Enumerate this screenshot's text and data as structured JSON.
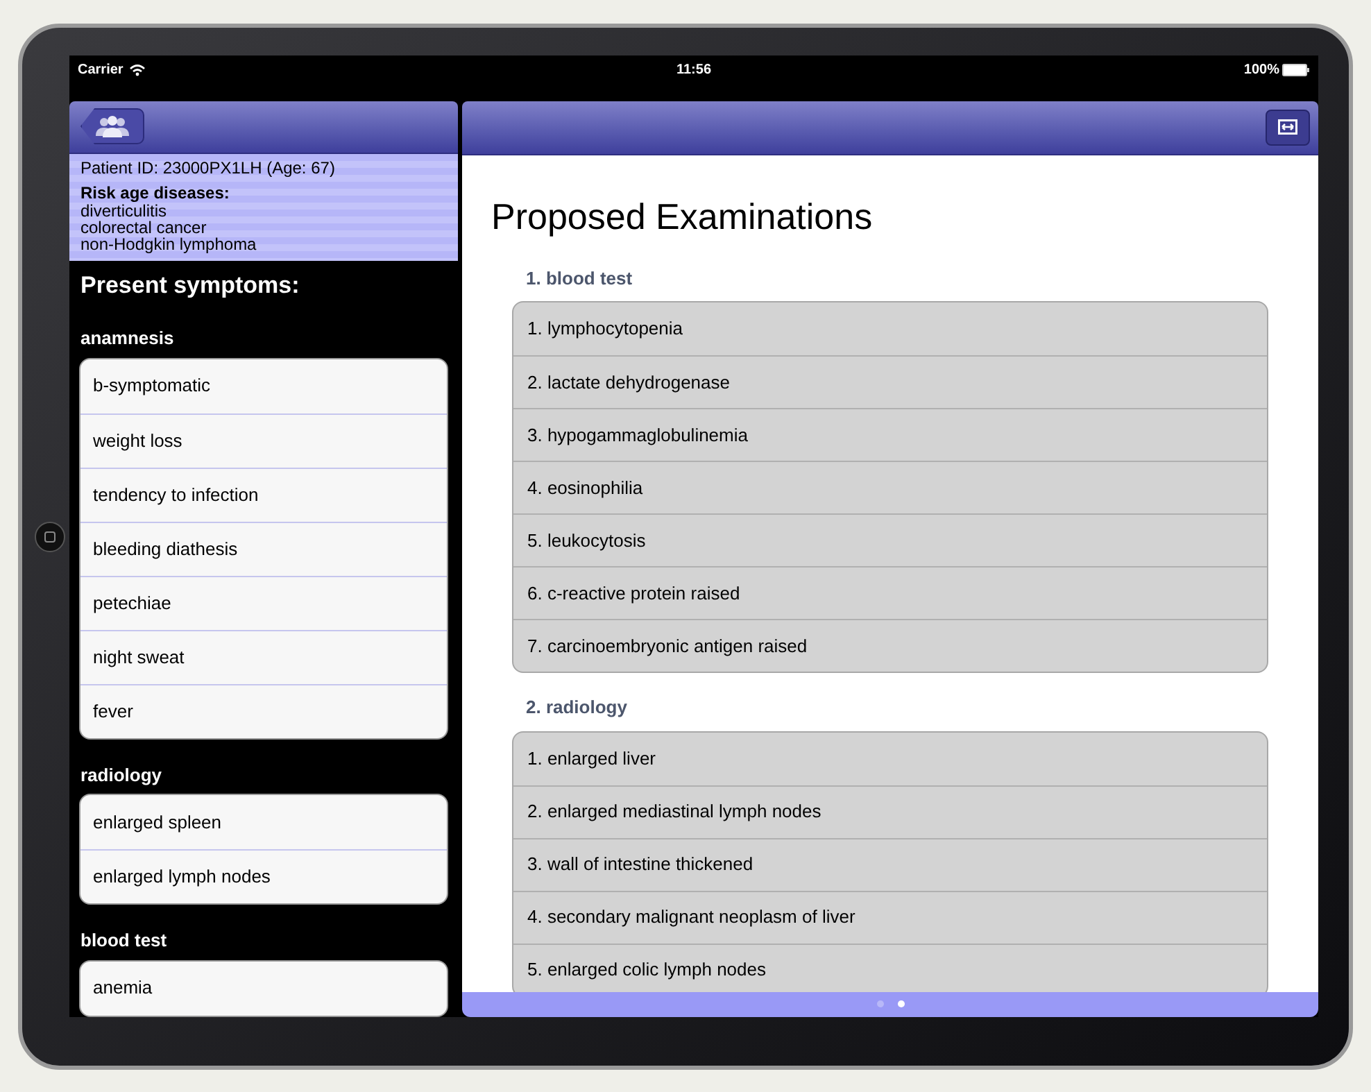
{
  "status_bar": {
    "carrier": "Carrier",
    "time": "11:56",
    "battery": "100%"
  },
  "patient": {
    "id_line": "Patient ID: 23000PX1LH (Age: 67)",
    "risk_heading": "Risk age diseases:",
    "risk_diseases": [
      "diverticulitis",
      "colorectal cancer",
      "non-Hodgkin lymphoma"
    ]
  },
  "symptoms_heading": "Present symptoms:",
  "symptom_groups": [
    {
      "title": "anamnesis",
      "items": [
        "b-symptomatic",
        "weight loss",
        "tendency to infection",
        "bleeding diathesis",
        "petechiae",
        "night sweat",
        "fever"
      ]
    },
    {
      "title": "radiology",
      "items": [
        "enlarged spleen",
        "enlarged lymph nodes"
      ]
    },
    {
      "title": "blood test",
      "items": [
        "anemia"
      ]
    }
  ],
  "examinations": {
    "title": "Proposed Examinations",
    "groups": [
      {
        "title": "1. blood test",
        "items": [
          "1. lymphocytopenia",
          "2. lactate dehydrogenase",
          "3. hypogammaglobulinemia",
          "4. eosinophilia",
          "5. leukocytosis",
          "6. c-reactive protein raised",
          "7. carcinoembryonic antigen raised"
        ]
      },
      {
        "title": "2. radiology",
        "items": [
          "1. enlarged liver",
          "2. enlarged mediastinal lymph nodes",
          "3. wall of intestine thickened",
          "4. secondary malignant neoplasm of liver",
          "5. enlarged colic lymph nodes"
        ]
      }
    ]
  },
  "pages": [
    {
      "selected": false
    },
    {
      "selected": true
    }
  ]
}
